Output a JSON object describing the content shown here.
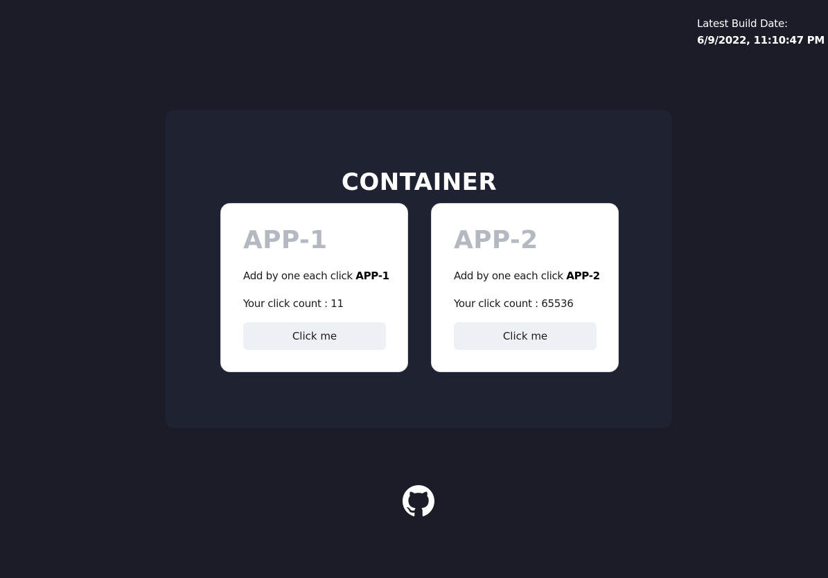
{
  "build": {
    "label": "Latest Build Date:",
    "date": "6/9/2022, 11:10:47 PM"
  },
  "container": {
    "title": "CONTAINER"
  },
  "apps": [
    {
      "title": "APP-1",
      "desc_prefix": "Add by one each click",
      "desc_name": "APP-1",
      "count_text": "Your click count : 11",
      "button_label": "Click me"
    },
    {
      "title": "APP-2",
      "desc_prefix": "Add by one each click",
      "desc_name": "APP-2",
      "count_text": "Your click count : 65536",
      "button_label": "Click me"
    }
  ],
  "footer": {
    "icon": "github-icon"
  },
  "colors": {
    "background": "#1c1b28",
    "panel": "#1e2231",
    "card": "#ffffff",
    "app_title": "#b4b8c0",
    "button": "#edf1f5"
  }
}
